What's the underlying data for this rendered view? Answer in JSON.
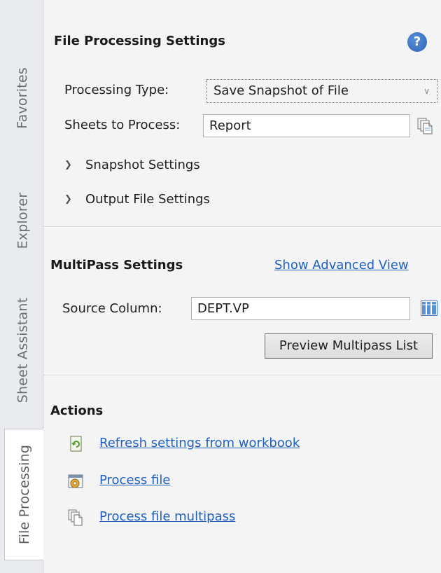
{
  "tabs": [
    {
      "label": "Favorites",
      "active": false
    },
    {
      "label": "Explorer",
      "active": false
    },
    {
      "label": "Sheet Assistant",
      "active": false
    },
    {
      "label": "File Processing",
      "active": true
    }
  ],
  "file_processing": {
    "title": "File Processing Settings",
    "help_icon": "?",
    "processing_type_label": "Processing Type:",
    "processing_type_value": "Save Snapshot of File",
    "sheets_label": "Sheets to Process:",
    "sheets_value": "Report",
    "snapshot_settings": "Snapshot Settings",
    "output_file_settings": "Output File Settings"
  },
  "multipass": {
    "title": "MultiPass Settings",
    "advanced_link": "Show Advanced View",
    "source_column_label": "Source Column:",
    "source_column_value": "DEPT.VP",
    "preview_button": "Preview Multipass List"
  },
  "actions": {
    "title": "Actions",
    "items": [
      {
        "label": "Refresh settings from workbook",
        "icon": "refresh-sheet-icon"
      },
      {
        "label": "Process file",
        "icon": "process-gear-icon"
      },
      {
        "label": "Process file multipass",
        "icon": "copy-pages-icon"
      }
    ]
  },
  "colors": {
    "link": "#1f5fbf",
    "help_icon": "#2d63b8",
    "panel_bg": "#f4f4f5",
    "tab_strip_bg": "#e9ebee"
  }
}
